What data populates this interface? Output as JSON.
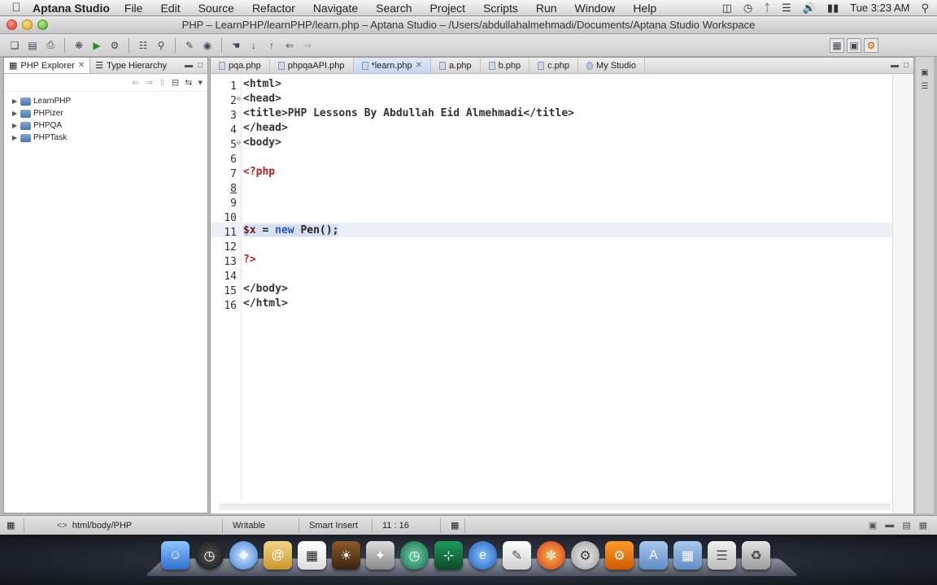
{
  "menubar": {
    "app_name": "Aptana Studio",
    "menus": [
      "File",
      "Edit",
      "Source",
      "Refactor",
      "Navigate",
      "Search",
      "Project",
      "Scripts",
      "Run",
      "Window",
      "Help"
    ],
    "clock": "Tue 3:23 AM"
  },
  "window": {
    "title": "PHP – LearnPHP/learnPHP/learn.php – Aptana Studio – /Users/abdullahalmehmadi/Documents/Aptana Studio Workspace"
  },
  "explorer": {
    "tabs": [
      {
        "label": "PHP Explorer",
        "active": true
      },
      {
        "label": "Type Hierarchy",
        "active": false
      }
    ],
    "projects": [
      "LearnPHP",
      "PHPizer",
      "PHPQA",
      "PHPTask"
    ]
  },
  "editor": {
    "tabs": [
      {
        "label": "pqa.php",
        "active": false
      },
      {
        "label": "phpqaAPI.php",
        "active": false
      },
      {
        "label": "*learn.php",
        "active": true
      },
      {
        "label": "a.php",
        "active": false
      },
      {
        "label": "b.php",
        "active": false
      },
      {
        "label": "c.php",
        "active": false
      },
      {
        "label": "My Studio",
        "active": false
      }
    ],
    "lines": [
      {
        "num": "1",
        "text": "<html>"
      },
      {
        "num": "2",
        "text": "<head>"
      },
      {
        "num": "3",
        "text": "<title>PHP Lessons By Abdullah Eid Almehmadi</title>"
      },
      {
        "num": "4",
        "text": "</head>"
      },
      {
        "num": "5",
        "text": "<body>"
      },
      {
        "num": "6",
        "text": ""
      },
      {
        "num": "7",
        "text": "<?php"
      },
      {
        "num": "8",
        "text": ""
      },
      {
        "num": "9",
        "text": ""
      },
      {
        "num": "10",
        "text": ""
      },
      {
        "num": "11",
        "text": "$x = new Pen();"
      },
      {
        "num": "12",
        "text": ""
      },
      {
        "num": "13",
        "text": "?>"
      },
      {
        "num": "14",
        "text": ""
      },
      {
        "num": "15",
        "text": "</body>"
      },
      {
        "num": "16",
        "text": "</html>"
      }
    ]
  },
  "statusbar": {
    "breadcrumb": "html/body/PHP",
    "mode": "Writable",
    "insert": "Smart Insert",
    "position": "11 : 16"
  },
  "colors": {
    "php_tag": "#b22222",
    "keyword": "#2850c8",
    "variable": "#6a1b1b",
    "active_tab": "#c5d7ef",
    "current_line": "#ebeff6"
  }
}
